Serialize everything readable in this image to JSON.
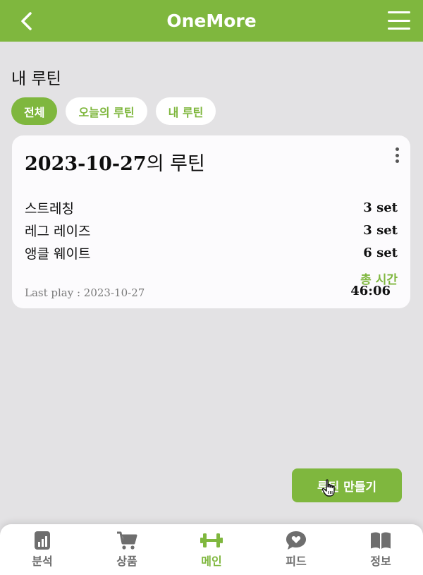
{
  "header": {
    "title": "OneMore",
    "back_icon": "chevron-left-icon",
    "menu_icon": "hamburger-menu-icon"
  },
  "section": {
    "title": "내 루틴"
  },
  "filters": [
    {
      "label": "전체",
      "active": true
    },
    {
      "label": "오늘의 루틴",
      "active": false
    },
    {
      "label": "내 루틴",
      "active": false
    }
  ],
  "routine_card": {
    "date": "2023-10-27",
    "title_suffix": "의 루틴",
    "more_icon": "kebab-menu-icon",
    "exercises": [
      {
        "name": "스트레칭",
        "sets": "3 set"
      },
      {
        "name": "레그 레이즈",
        "sets": "3 set"
      },
      {
        "name": "앵클 웨이트",
        "sets": "6 set"
      }
    ],
    "total_label": "총 시간",
    "total_value": "46:06",
    "last_play": "Last play : 2023-10-27"
  },
  "create_button": {
    "label": "루틴 만들기"
  },
  "bottom_nav": [
    {
      "label": "분석",
      "icon": "bar-chart-icon",
      "active": false
    },
    {
      "label": "상품",
      "icon": "shopping-cart-icon",
      "active": false
    },
    {
      "label": "메인",
      "icon": "dumbbell-icon",
      "active": true
    },
    {
      "label": "피드",
      "icon": "heart-chat-icon",
      "active": false
    },
    {
      "label": "정보",
      "icon": "book-icon",
      "active": false
    }
  ],
  "colors": {
    "accent": "#7fb73e",
    "background": "#e3e2e4",
    "card": "#fcfbfd",
    "nav_inactive": "#6e6e6e"
  }
}
